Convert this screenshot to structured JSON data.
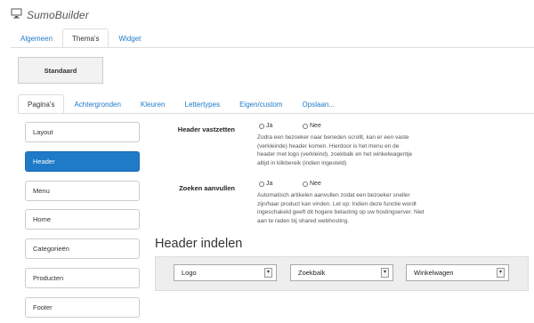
{
  "app": {
    "title": "SumoBuilder"
  },
  "top_tabs": [
    {
      "label": "Algemeen",
      "active": false
    },
    {
      "label": "Thema's",
      "active": true
    },
    {
      "label": "Widget",
      "active": false
    }
  ],
  "theme": {
    "name": "Standaard"
  },
  "sub_tabs": [
    {
      "label": "Pagina's",
      "active": true
    },
    {
      "label": "Achtergronden",
      "active": false
    },
    {
      "label": "Kleuren",
      "active": false
    },
    {
      "label": "Lettertypes",
      "active": false
    },
    {
      "label": "Eigen/custom",
      "active": false
    },
    {
      "label": "Opslaan...",
      "active": false
    }
  ],
  "sidebar": {
    "items": [
      {
        "label": "Layout",
        "active": false
      },
      {
        "label": "Header",
        "active": true
      },
      {
        "label": "Menu",
        "active": false
      },
      {
        "label": "Home",
        "active": false
      },
      {
        "label": "Categorieën",
        "active": false
      },
      {
        "label": "Producten",
        "active": false
      },
      {
        "label": "Footer",
        "active": false
      }
    ]
  },
  "settings": {
    "header_vastzetten": {
      "label": "Header vastzetten",
      "options": [
        "Ja",
        "Nee"
      ],
      "help": "Zodra een bezoeker naar beneden scrollt, kan er een vaste (verkleinde) header komen. Hierdoor is het menu en de header met logo (verkleind), zoekbalk en het winkelwagentje altijd in klikbereik (indien ingesteld)"
    },
    "zoeken_aanvullen": {
      "label": "Zoeken aanvullen",
      "options": [
        "Ja",
        "Nee"
      ],
      "help": "Automatisch artikelen aanvullen zodat een bezoeker sneller zijn/haar product kan vinden. Let op: Indien deze functie wordt ingeschakeld geeft dit hogere belasting op uw hostingserver. Niet aan te raden bij shared webhosting."
    }
  },
  "header_layout": {
    "title": "Header indelen",
    "selects": [
      {
        "value": "Logo"
      },
      {
        "value": "Zoekbalk"
      },
      {
        "value": "Winkelwagen"
      }
    ]
  },
  "colors": {
    "accent": "#1f7ac7",
    "border": "#cccccc",
    "panel_bg": "#eeeeee"
  },
  "icons": {
    "app": "monitor-icon",
    "select_arrow": "select-arrow-icon"
  }
}
